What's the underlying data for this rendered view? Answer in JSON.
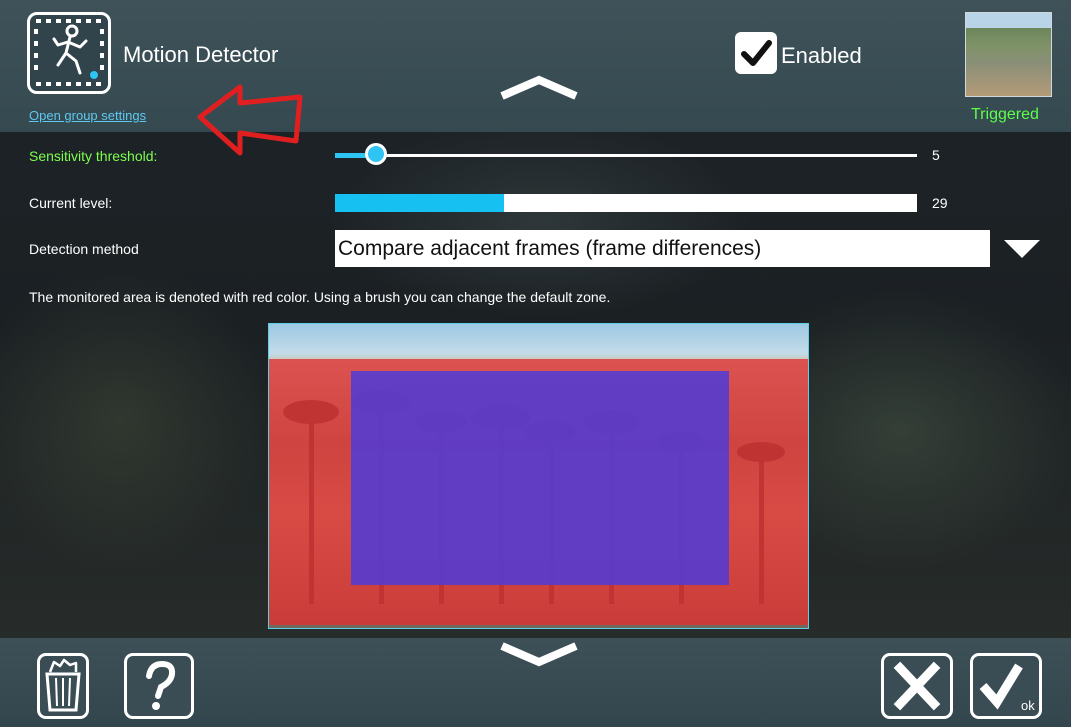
{
  "header": {
    "title": "Motion Detector",
    "group_link": "Open group settings",
    "enabled_label": "Enabled",
    "enabled_checked": true,
    "status": "Triggered",
    "status_color": "#5cff4a"
  },
  "settings": {
    "sensitivity": {
      "label": "Sensitivity threshold:",
      "value": "5",
      "fraction": 0.07
    },
    "current_level": {
      "label": "Current level:",
      "value": "29",
      "fraction": 0.29
    },
    "detection_method": {
      "label": "Detection method",
      "selected": "Compare adjacent frames (frame differences)"
    },
    "info": "The monitored area is denoted with red color. Using a brush you can change the default zone."
  },
  "colors": {
    "accent": "#16c0f1",
    "zone_monitored": "#e13030",
    "zone_brush": "#543cd2",
    "arrow": "#e02020"
  },
  "icons": {
    "detector": "running-man-film-icon",
    "trash": "trash-icon",
    "help": "question-icon",
    "close": "close-icon",
    "ok": "ok-check-icon"
  }
}
